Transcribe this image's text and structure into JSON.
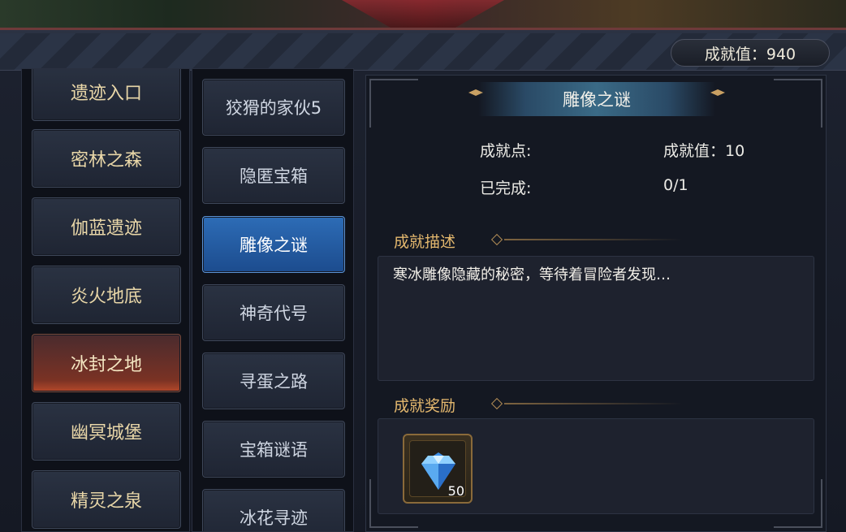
{
  "header": {
    "score_label": "成就值：940"
  },
  "categories": [
    {
      "label": "遗迹入口"
    },
    {
      "label": "密林之森"
    },
    {
      "label": "伽蓝遗迹"
    },
    {
      "label": "炎火地底"
    },
    {
      "label": "冰封之地",
      "active": true
    },
    {
      "label": "幽冥城堡"
    },
    {
      "label": "精灵之泉"
    }
  ],
  "achievements": [
    {
      "label": "狡猾的家伙5"
    },
    {
      "label": "隐匿宝箱"
    },
    {
      "label": "雕像之谜",
      "active": true
    },
    {
      "label": "神奇代号"
    },
    {
      "label": "寻蛋之路"
    },
    {
      "label": "宝箱谜语"
    },
    {
      "label": "冰花寻迹"
    }
  ],
  "detail": {
    "title": "雕像之谜",
    "points_label": "成就点:",
    "points_value": "成就值：10",
    "completed_label": "已完成:",
    "completed_value": "0/1",
    "description_heading": "成就描述",
    "description_text": "寒冰雕像隐藏的秘密，等待着冒险者发现…",
    "reward_heading": "成就奖励",
    "reward": {
      "icon": "diamond-icon",
      "count": "50"
    }
  },
  "colors": {
    "accent_gold": "#e4b86e",
    "active_blue": "#2d6cb6",
    "active_red": "#7a3224"
  }
}
